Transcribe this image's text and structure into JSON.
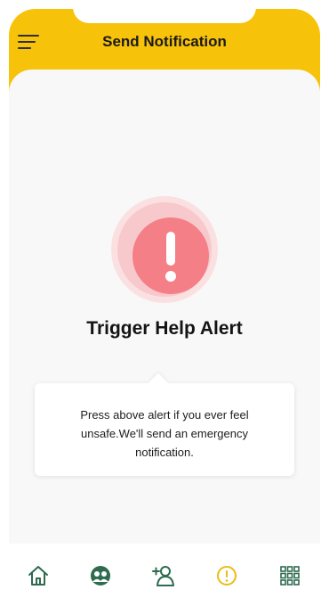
{
  "header": {
    "title": "Send Notification"
  },
  "alert": {
    "icon": "exclamation-icon",
    "title": "Trigger Help Alert",
    "description": "Press above alert if you ever feel unsafe.We'll send an emergency notification."
  },
  "bottom_nav": {
    "items": [
      {
        "icon": "home-icon"
      },
      {
        "icon": "contacts-group-icon"
      },
      {
        "icon": "add-user-icon"
      },
      {
        "icon": "alert-icon",
        "active": true
      },
      {
        "icon": "grid-icon"
      }
    ]
  },
  "colors": {
    "header": "#f6c20a",
    "nav_icon": "#2e6b4f",
    "nav_active": "#e8bd16",
    "alert_core": "#f47f86",
    "alert_ring_inner": "#f8c9cc",
    "alert_ring_outer": "#fbe0e2"
  }
}
